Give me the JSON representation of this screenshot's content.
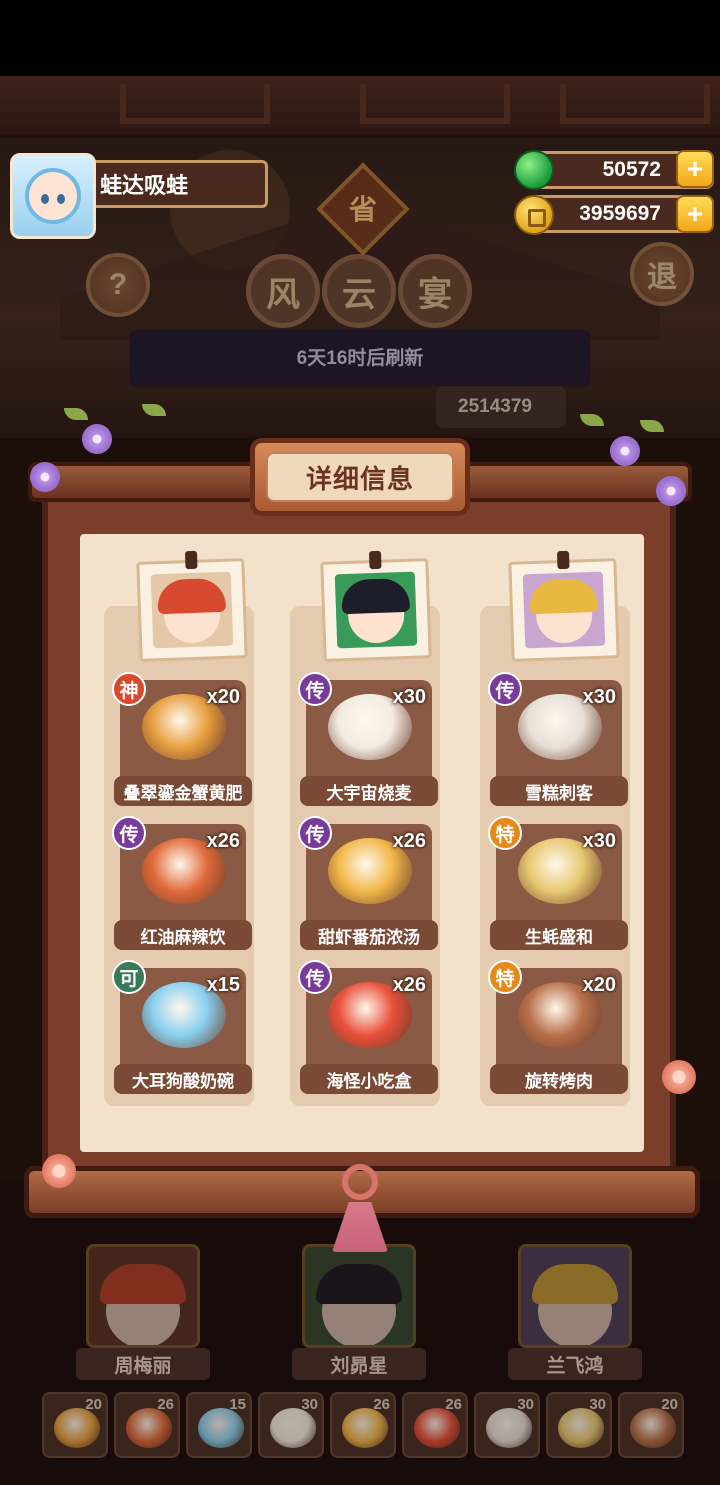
{
  "player": {
    "name": "蛙达吸蛙",
    "avatar_icon": "player-avatar-icon"
  },
  "currency": {
    "jade": "50572",
    "coins": "3959697",
    "plus": "+"
  },
  "header": {
    "seal": "省",
    "title_chars": [
      "风",
      "云",
      "宴"
    ],
    "refresh": "6天16时后刷新",
    "score": "2514379",
    "help": "?",
    "back": "退"
  },
  "panel": {
    "title": "详细信息",
    "chefs": [
      {
        "dishes": [
          {
            "badge": "神",
            "tier": "shen",
            "qty": "x20",
            "name": "叠翠鎏金蟹黄肥",
            "color": "#e8a040"
          },
          {
            "badge": "传",
            "tier": "chuan",
            "qty": "x26",
            "name": "红油麻辣饮",
            "color": "#e06a3a"
          },
          {
            "badge": "可",
            "tier": "ke",
            "qty": "x15",
            "name": "大耳狗酸奶碗",
            "color": "#8ad0f0"
          }
        ]
      },
      {
        "dishes": [
          {
            "badge": "传",
            "tier": "chuan",
            "qty": "x30",
            "name": "大宇宙烧麦",
            "color": "#f4ece2"
          },
          {
            "badge": "传",
            "tier": "chuan",
            "qty": "x26",
            "name": "甜虾番茄浓汤",
            "color": "#f2b84a"
          },
          {
            "badge": "传",
            "tier": "chuan",
            "qty": "x26",
            "name": "海怪小吃盒",
            "color": "#e8503a"
          }
        ]
      },
      {
        "dishes": [
          {
            "badge": "传",
            "tier": "chuan",
            "qty": "x30",
            "name": "雪糕刺客",
            "color": "#e8e0d8"
          },
          {
            "badge": "特",
            "tier": "te",
            "qty": "x30",
            "name": "生蚝盛和",
            "color": "#e8c870"
          },
          {
            "badge": "特",
            "tier": "te",
            "qty": "x20",
            "name": "旋转烤肉",
            "color": "#b8704a"
          }
        ]
      }
    ]
  },
  "bottom": {
    "chef_names": [
      "周梅丽",
      "刘昴星",
      "兰飞鸿"
    ],
    "dish_slots": [
      {
        "num": "20",
        "color": "#e8a040"
      },
      {
        "num": "26",
        "color": "#e06a3a"
      },
      {
        "num": "15",
        "color": "#8ad0f0"
      },
      {
        "num": "30",
        "color": "#f4ece2"
      },
      {
        "num": "26",
        "color": "#f2b84a"
      },
      {
        "num": "26",
        "color": "#e8503a"
      },
      {
        "num": "30",
        "color": "#e8e0d8"
      },
      {
        "num": "30",
        "color": "#e8c870"
      },
      {
        "num": "20",
        "color": "#b8704a"
      }
    ]
  }
}
